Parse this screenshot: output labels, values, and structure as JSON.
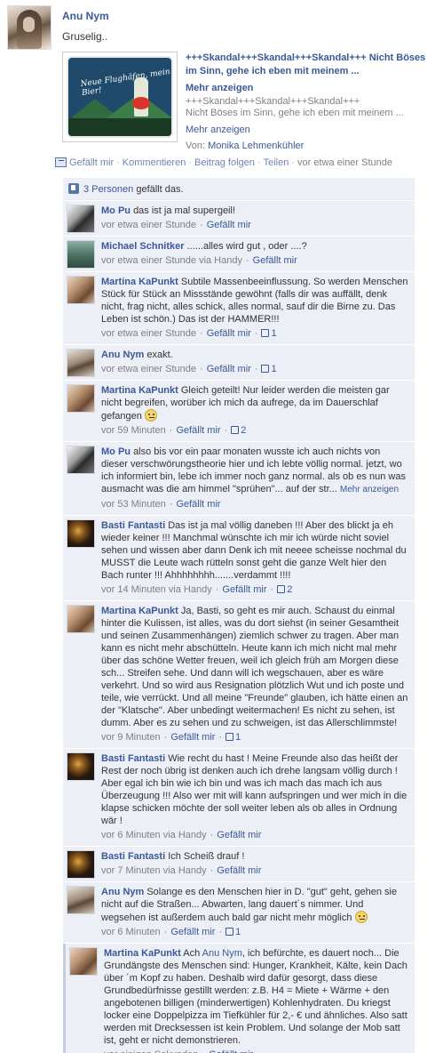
{
  "post": {
    "author": "Anu Nym",
    "message": "Gruselig..",
    "attachment": {
      "title": "+++Skandal+++Skandal+++Skandal+++ Nicht Böses im Sinn, gehe ich eben mit meinem ...",
      "more_label": "Mehr anzeigen",
      "subtitle_line1": "+++Skandal+++Skandal+++Skandal+++",
      "subtitle_line2": "Nicht Böses im Sinn, gehe ich eben mit meinem ...",
      "more_label_2": "Mehr anzeigen",
      "via_prefix": "Von:",
      "via_name": "Monika Lehmenkühler",
      "thumb_text": "Neue Flughäfen, mein Bier!"
    },
    "actions": {
      "like": "Gefällt mir",
      "comment": "Kommentieren",
      "follow": "Beitrag folgen",
      "share": "Teilen",
      "time": "vor etwa einer Stunde",
      "separator": "·"
    },
    "likes": {
      "count_label": "3 Personen",
      "suffix": "gefällt das."
    }
  },
  "comments": [
    {
      "name": "Mo Pu",
      "text": "das ist ja mal supergeil!",
      "time": "vor etwa einer Stunde",
      "like_label": "Gefällt mir",
      "likes": ""
    },
    {
      "name": "Michael Schnitker",
      "text": "......alles wird gut , oder ....?",
      "time": "vor etwa einer Stunde via Handy",
      "like_label": "Gefällt mir",
      "likes": ""
    },
    {
      "name": "Martina KaPunkt",
      "text": "Subtile Massenbeeinflussung. So werden Menschen Stück für Stück an Missstände gewöhnt (falls dir was auffällt, denk nicht, frag nicht, alles schick, alles normal, sauf dir die Birne zu. Das Leben ist schön.) Das ist der HAMMER!!!",
      "time": "vor etwa einer Stunde",
      "like_label": "Gefällt mir",
      "likes": "1"
    },
    {
      "name": "Anu Nym",
      "text": "exakt.",
      "time": "vor etwa einer Stunde",
      "like_label": "Gefällt mir",
      "likes": "1"
    },
    {
      "name": "Martina KaPunkt",
      "text": "Gleich geteilt! Nur leider werden die meisten gar nicht begreifen, worüber ich mich da aufrege, da im Dauerschlaf gefangen",
      "time": "vor 59 Minuten",
      "like_label": "Gefällt mir",
      "likes": "2"
    },
    {
      "name": "Mo Pu",
      "text": "also bis vor ein paar monaten wusste ich auch nichts von dieser verschwörungstheorie hier und ich lebte völlig normal. jetzt, wo ich informiert bin, lebe ich immer noch ganz normal. als ob es nun was ausmacht was die am himmel \"sprühen\"... auf der str...",
      "more": "Mehr anzeigen",
      "time": "vor 53 Minuten",
      "like_label": "Gefällt mir",
      "likes": ""
    },
    {
      "name": "Basti Fantasti",
      "text": "Das ist ja mal völlig daneben !!! Aber des blickt ja eh wieder keiner !!! Manchmal wünschte ich mir ich würde nicht soviel sehen und wissen aber dann Denk ich mit neeee scheisse nochmal du MUSST die Leute wach rütteln sonst geht die ganze Welt hier den Bach runter !!! Ahhhhhhhh.......verdammt !!!!",
      "time": "vor 14 Minuten via Handy",
      "like_label": "Gefällt mir",
      "likes": "2"
    },
    {
      "name": "Martina KaPunkt",
      "text": "Ja, Basti, so geht es mir auch. Schaust du einmal hinter die Kulissen, ist alles, was du dort siehst (in seiner Gesamtheit und seinen Zusammenhängen) ziemlich schwer zu tragen. Aber man kann es nicht mehr abschütteln. Heute kann ich mich nicht mal mehr über das schöne Wetter freuen, weil ich gleich früh am Morgen diese sch... Streifen sehe. Und dann will ich wegschauen, aber es wäre verkehrt. Und so wird aus Resignation plötzlich Wut und ich poste und teile, wie verrückt. Und all meine \"Freunde\" glauben, ich hätte einen an der \"Klatsche\". Aber unbedingt weitermachen! Es nicht zu sehen, ist dumm. Aber es zu sehen und zu schweigen, ist das Allerschlimmste!",
      "time": "vor 9 Minuten",
      "like_label": "Gefällt mir",
      "likes": "1"
    },
    {
      "name": "Basti Fantasti",
      "text": "Wie recht du hast ! Meine Freunde also das heißt der Rest der noch übrig ist denken auch ich drehe langsam völlig durch ! Aber egal ich bin wie ich bin und was ich mach das mach ich aus Überzeugung !!! Also wer mit will kann aufspringen und wer mich in die klapse schicken möchte der soll weiter leben als ob alles in Ordnung wär !",
      "time": "vor 6 Minuten via Handy",
      "like_label": "Gefällt mir",
      "likes": ""
    },
    {
      "name": "Basti Fantasti",
      "text": "Ich Scheiß drauf !",
      "time": "vor 7 Minuten via Handy",
      "like_label": "Gefällt mir",
      "likes": ""
    },
    {
      "name": "Anu Nym",
      "text": "Solange es den Menschen hier in D. \"gut\" geht, gehen sie nicht auf die Straßen... Abwarten, lang dauert´s nimmer. Und wegsehen ist außerdem auch bald gar nicht mehr möglich",
      "time": "vor 6 Minuten",
      "like_label": "Gefällt mir",
      "likes": "1"
    },
    {
      "name": "Martina KaPunkt",
      "text_prefix": "Ach",
      "mention": "Anu Nym",
      "text": ", ich befürchte, es dauert noch... Die Grundängste des Menschen sind: Hunger, Krankheit, Kälte, kein Dach über ´m Kopf zu haben. Deshalb wird dafür gesorgt, dass diese Grundbedürfnisse gestillt werden: z.B. H4 = Miete + Wärme + den angebotenen billigen (minderwertigen) Kohlenhydraten. Du kriegst locker eine Doppelpizza im Tiefkühler für 2,- € und ähnliches. Also satt werden mit Drecksessen ist kein Problem. Und solange der Mob satt ist, geht er nicht demonstrieren.",
      "time": "vor einigen Sekunden",
      "like_label": "Gefällt mir",
      "likes": ""
    }
  ]
}
